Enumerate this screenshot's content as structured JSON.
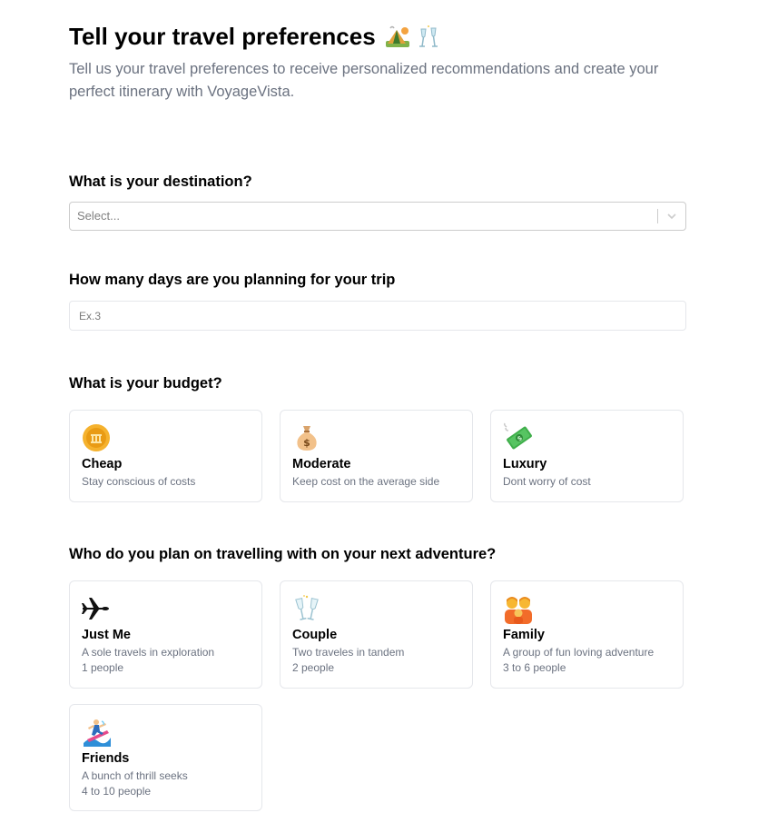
{
  "header": {
    "title": "Tell your travel preferences",
    "subtitle": "Tell us your travel preferences to receive personalized recommendations and create your perfect itinerary with VoyageVista."
  },
  "destination": {
    "question": "What is your destination?",
    "placeholder": "Select..."
  },
  "days": {
    "question": "How many days are you planning for your trip",
    "placeholder": "Ex.3"
  },
  "budget": {
    "question": "What is your budget?",
    "options": [
      {
        "title": "Cheap",
        "desc": "Stay conscious of costs",
        "icon": "coin-icon"
      },
      {
        "title": "Moderate",
        "desc": "Keep cost on the average side",
        "icon": "money-bag-icon"
      },
      {
        "title": "Luxury",
        "desc": "Dont worry of cost",
        "icon": "flying-money-icon"
      }
    ]
  },
  "travelers": {
    "question": "Who do you plan on travelling with on your next adventure?",
    "options": [
      {
        "title": "Just Me",
        "desc": "A sole travels in exploration",
        "people": "1 people",
        "icon": "airplane-icon"
      },
      {
        "title": "Couple",
        "desc": "Two traveles in tandem",
        "people": "2 people",
        "icon": "clinking-glasses-icon"
      },
      {
        "title": "Family",
        "desc": "A group of fun loving adventure",
        "people": "3 to 6 people",
        "icon": "family-icon"
      },
      {
        "title": "Friends",
        "desc": "A bunch of thrill seeks",
        "people": "4 to 10 people",
        "icon": "surfer-icon"
      }
    ]
  }
}
